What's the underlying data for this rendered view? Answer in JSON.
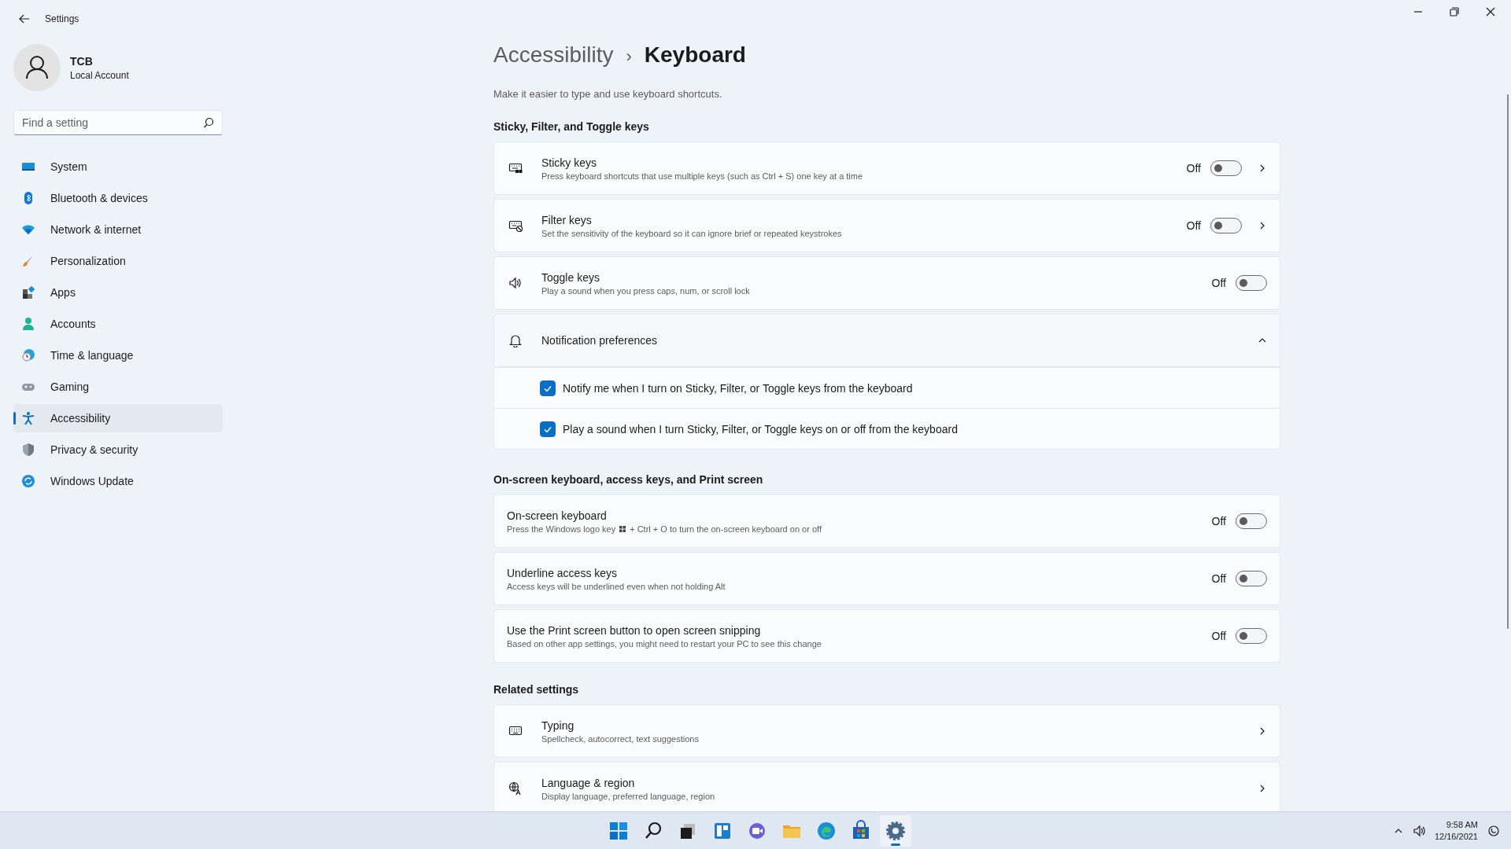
{
  "window": {
    "title": "Settings"
  },
  "account": {
    "name": "TCB",
    "type": "Local Account"
  },
  "search": {
    "placeholder": "Find a setting"
  },
  "sidebar": {
    "items": [
      {
        "label": "System",
        "selected": false
      },
      {
        "label": "Bluetooth & devices",
        "selected": false
      },
      {
        "label": "Network & internet",
        "selected": false
      },
      {
        "label": "Personalization",
        "selected": false
      },
      {
        "label": "Apps",
        "selected": false
      },
      {
        "label": "Accounts",
        "selected": false
      },
      {
        "label": "Time & language",
        "selected": false
      },
      {
        "label": "Gaming",
        "selected": false
      },
      {
        "label": "Accessibility",
        "selected": true
      },
      {
        "label": "Privacy & security",
        "selected": false
      },
      {
        "label": "Windows Update",
        "selected": false
      }
    ]
  },
  "breadcrumb": {
    "parent": "Accessibility",
    "separator": "›",
    "current": "Keyboard"
  },
  "subtitle": "Make it easier to type and use keyboard shortcuts.",
  "sections": [
    {
      "heading": "Sticky, Filter, and Toggle keys",
      "rows": [
        {
          "kind": "toggle",
          "title": "Sticky keys",
          "description": "Press keyboard shortcuts that use multiple keys (such as Ctrl + S) one key at a time",
          "state_label": "Off",
          "on": false,
          "chevron": true
        },
        {
          "kind": "toggle",
          "title": "Filter keys",
          "description": "Set the sensitivity of the keyboard so it can ignore brief or repeated keystrokes",
          "state_label": "Off",
          "on": false,
          "chevron": true
        },
        {
          "kind": "toggle",
          "title": "Toggle keys",
          "description": "Play a sound when you press caps, num, or scroll lock",
          "state_label": "Off",
          "on": false,
          "chevron": false
        },
        {
          "kind": "expander",
          "title": "Notification preferences",
          "expanded": true,
          "options": [
            {
              "label": "Notify me when I turn on Sticky, Filter, or Toggle keys from the keyboard",
              "checked": true
            },
            {
              "label": "Play a sound when I turn Sticky, Filter, or Toggle keys on or off from the keyboard",
              "checked": true
            }
          ]
        }
      ]
    },
    {
      "heading": "On-screen keyboard, access keys, and Print screen",
      "rows": [
        {
          "kind": "toggle",
          "title": "On-screen keyboard",
          "description_before_icon": "Press the Windows logo key",
          "description": "+ Ctrl + O to turn the on-screen keyboard on or off",
          "state_label": "Off",
          "on": false,
          "chevron": false
        },
        {
          "kind": "toggle",
          "title": "Underline access keys",
          "description": "Access keys will be underlined even when not holding Alt",
          "state_label": "Off",
          "on": false,
          "chevron": false
        },
        {
          "kind": "toggle",
          "title": "Use the Print screen button to open screen snipping",
          "description": "Based on other app settings, you might need to restart your PC to see this change",
          "state_label": "Off",
          "on": false,
          "chevron": false
        }
      ]
    },
    {
      "heading": "Related settings",
      "rows": [
        {
          "kind": "link",
          "title": "Typing",
          "description": "Spellcheck, autocorrect, text suggestions"
        },
        {
          "kind": "link",
          "title": "Language & region",
          "description": "Display language, preferred language, region"
        }
      ]
    }
  ],
  "taskbar": {
    "apps": [
      {
        "selected": false
      },
      {
        "selected": false
      },
      {
        "selected": false
      },
      {
        "selected": false
      },
      {
        "selected": false
      },
      {
        "selected": false
      },
      {
        "selected": false
      },
      {
        "selected": false
      },
      {
        "selected": true
      }
    ],
    "time": "9:58 AM",
    "date": "12/16/2021"
  }
}
